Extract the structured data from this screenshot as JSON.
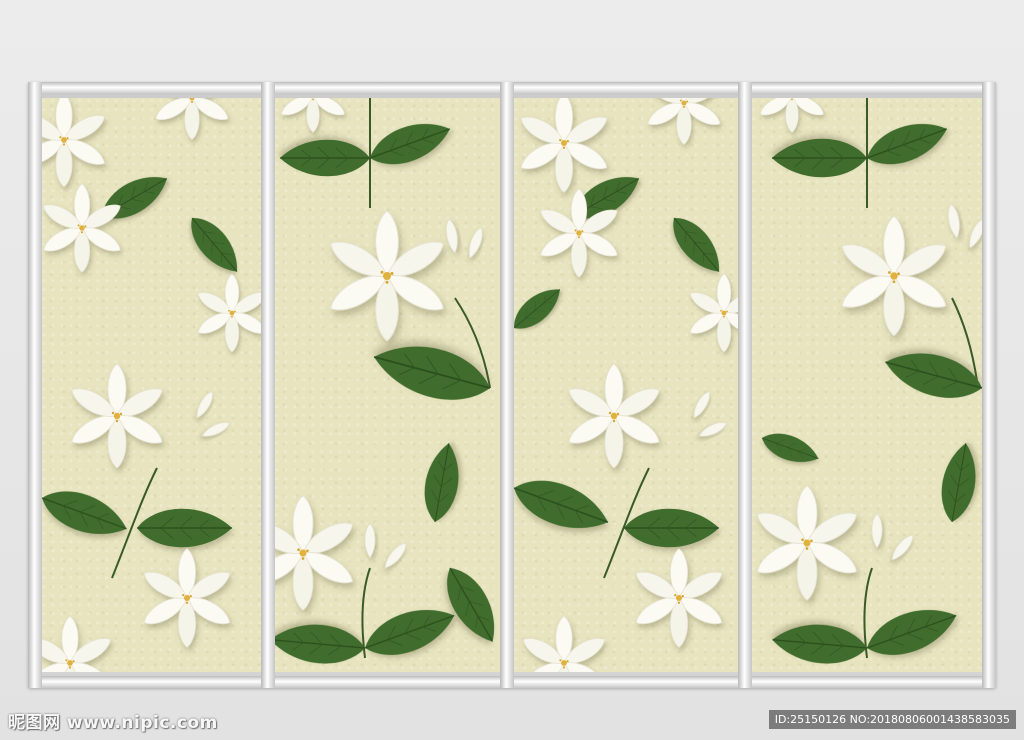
{
  "image": {
    "subject": "Four-panel white jasmine flower wall mural inside a silver frame",
    "panel_background_color": "#e7e4bf",
    "leaf_color": "#3e6b2c",
    "petal_color": "#faf9f0",
    "frame_color": "#d9d9d9"
  },
  "watermark": {
    "site": "昵图网 www.nipic.com",
    "id_text": "ID:25150126 NO:20180806001438583035"
  }
}
